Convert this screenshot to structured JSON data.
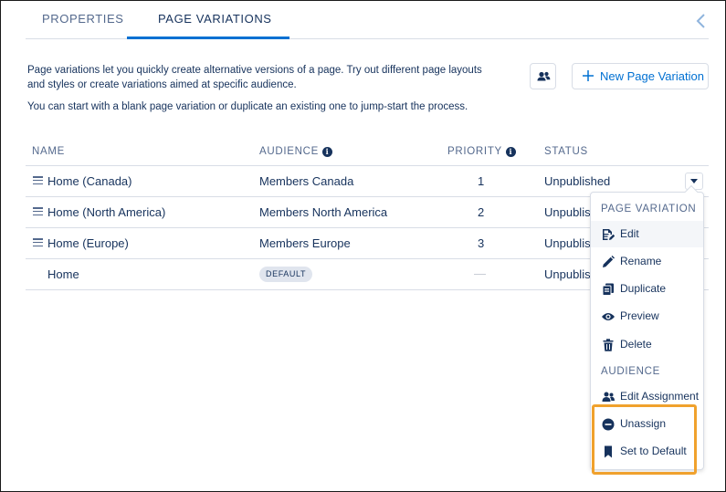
{
  "tabs": [
    {
      "label": "PROPERTIES"
    },
    {
      "label": "PAGE VARIATIONS"
    }
  ],
  "description": {
    "line1": "Page variations let you quickly create alternative versions of a page. Try out different page layouts and styles or create variations aimed at specific audience.",
    "line2": "You can start with a blank page variation or duplicate an existing one to jump-start the process."
  },
  "toolbar": {
    "new_button_label": "New Page Variation"
  },
  "table": {
    "headers": {
      "name": "NAME",
      "audience": "AUDIENCE",
      "priority": "PRIORITY",
      "status": "STATUS"
    },
    "rows": [
      {
        "name": "Home (Canada)",
        "audience": "Members Canada",
        "priority": "1",
        "status": "Unpublished"
      },
      {
        "name": "Home (North America)",
        "audience": "Members North America",
        "priority": "2",
        "status": "Unpublish"
      },
      {
        "name": "Home (Europe)",
        "audience": "Members Europe",
        "priority": "3",
        "status": "Unpublish"
      },
      {
        "name": "Home",
        "audience_badge": "DEFAULT",
        "priority": "",
        "status": "Unpublish"
      }
    ]
  },
  "menu": {
    "section1": "PAGE VARIATION",
    "items1": [
      {
        "label": "Edit",
        "icon": "edit-icon"
      },
      {
        "label": "Rename",
        "icon": "pencil-icon"
      },
      {
        "label": "Duplicate",
        "icon": "copy-icon"
      },
      {
        "label": "Preview",
        "icon": "eye-icon"
      },
      {
        "label": "Delete",
        "icon": "trash-icon"
      }
    ],
    "section2": "AUDIENCE",
    "items2": [
      {
        "label": "Edit Assignment",
        "icon": "users-icon"
      },
      {
        "label": "Unassign",
        "icon": "minus-circle-icon"
      },
      {
        "label": "Set to Default",
        "icon": "bookmark-icon"
      }
    ]
  },
  "colors": {
    "text": "#16325c",
    "muted": "#54698d",
    "accent": "#0070d2",
    "border": "#d8dde6",
    "highlight": "#f0a12d"
  }
}
